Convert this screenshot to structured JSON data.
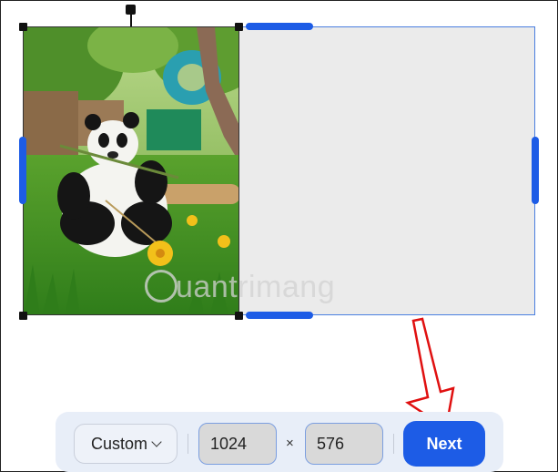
{
  "toolbar": {
    "size_preset": "Custom",
    "width_value": "1024",
    "height_value": "576",
    "times_symbol": "×",
    "next_label": "Next"
  },
  "watermark": {
    "text": "uantrimang"
  },
  "colors": {
    "accent": "#1d5ce6",
    "canvas_bg": "#ebebeb",
    "annotation_arrow": "#e01010"
  }
}
